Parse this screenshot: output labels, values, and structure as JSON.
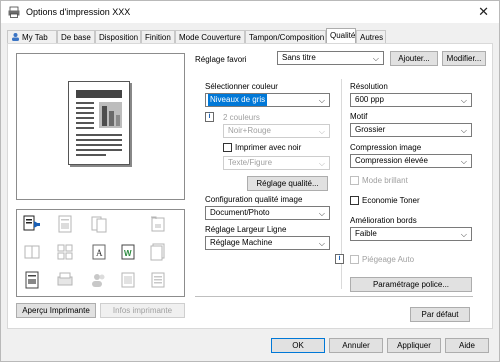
{
  "window": {
    "title": "Options d'impression XXX"
  },
  "tabs": [
    "My Tab",
    "De base",
    "Disposition",
    "Finition",
    "Mode Couverture",
    "Tampon/Composition",
    "Qualité",
    "Autres"
  ],
  "favorite": {
    "label": "Réglage favori",
    "value": "Sans titre",
    "add": "Ajouter...",
    "modify": "Modifier..."
  },
  "left": {
    "preview_printer": "Aperçu Imprimante",
    "printer_info": "Infos imprimante"
  },
  "color": {
    "label": "Sélectionner couleur",
    "value": "Niveaux de gris",
    "two_colors": "2 couleurs",
    "two_colors_value": "Noir+Rouge",
    "print_black": "Imprimer avec noir",
    "print_black_value": "Texte/Figure",
    "quality_settings": "Réglage qualité..."
  },
  "image_quality": {
    "label": "Configuration qualité image",
    "value": "Document/Photo"
  },
  "line_width": {
    "label": "Réglage Largeur Ligne",
    "value": "Réglage Machine"
  },
  "resolution": {
    "label": "Résolution",
    "value": "600 ppp"
  },
  "pattern": {
    "label": "Motif",
    "value": "Grossier"
  },
  "compression": {
    "label": "Compression image",
    "value": "Compression élevée"
  },
  "glossy": "Mode brillant",
  "toner_save": "Economie Toner",
  "edge_enhance": {
    "label": "Amélioration bords",
    "value": "Faible"
  },
  "trap": "Piégeage Auto",
  "font_settings": "Paramétrage police...",
  "default_button": "Par défaut",
  "footer": {
    "ok": "OK",
    "cancel": "Annuler",
    "apply": "Appliquer",
    "help": "Aide"
  },
  "colors": {
    "accent": "#0078d7",
    "tab_active_bg": "#ffffff",
    "window_bg": "#f0f0f0"
  }
}
